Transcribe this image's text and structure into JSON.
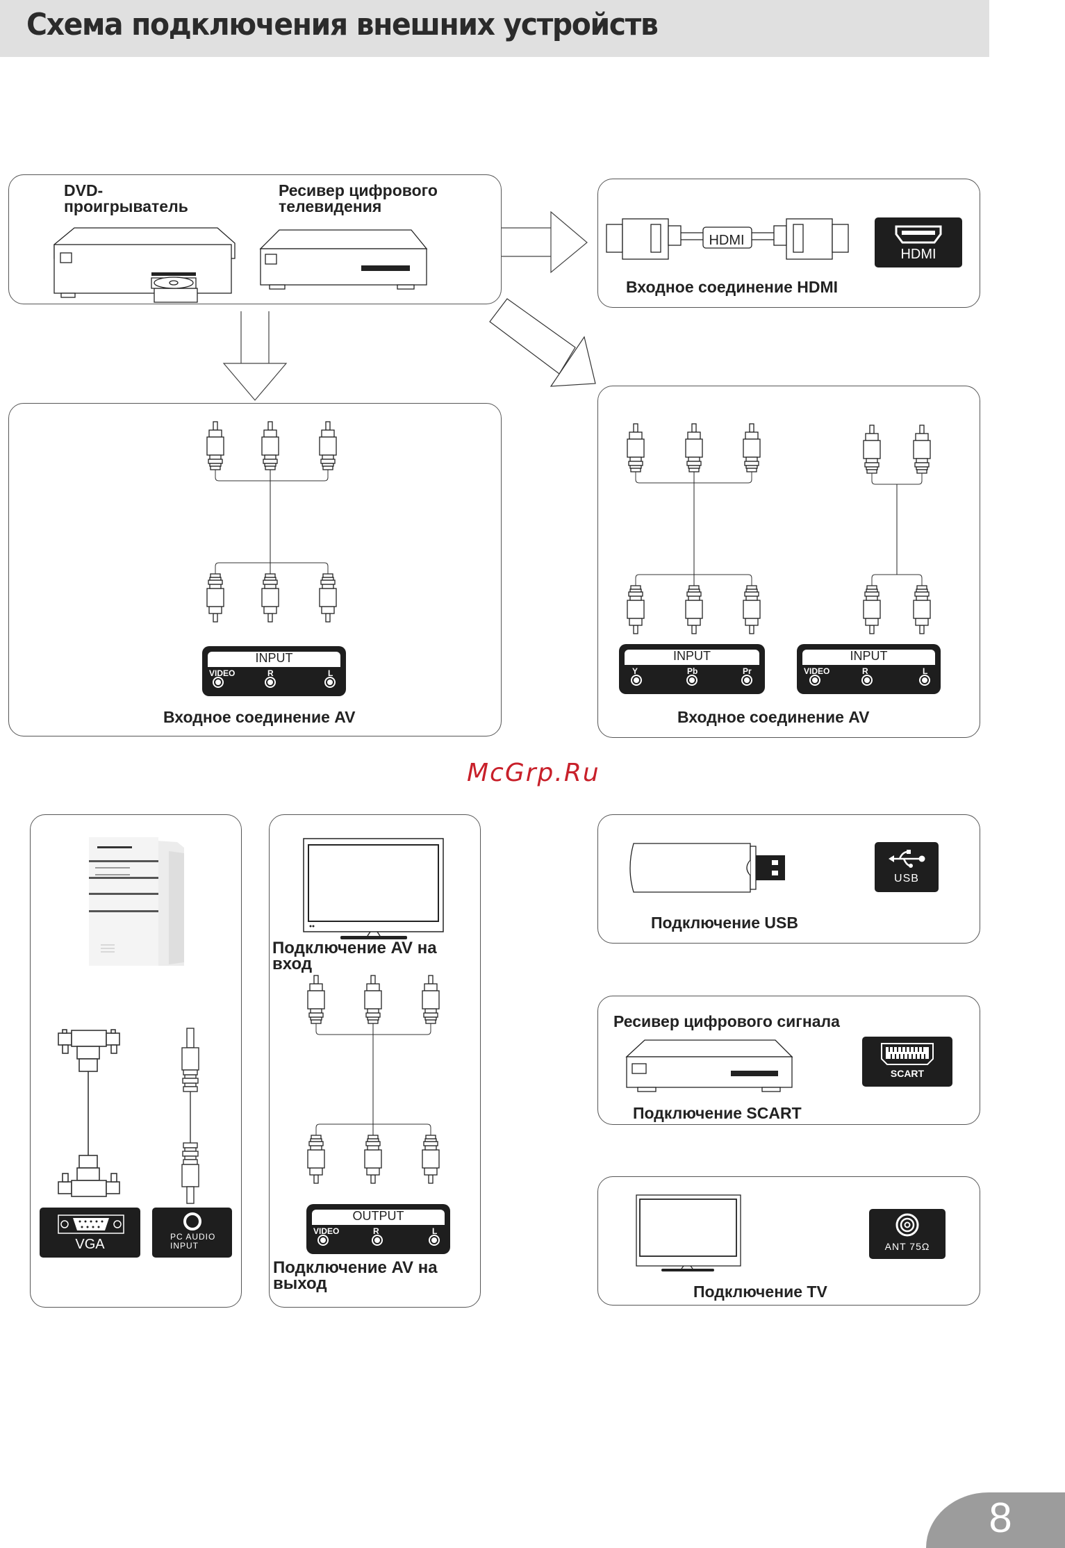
{
  "header": {
    "title": "Схема подключения внешних устройств"
  },
  "watermark": "McGrp.Ru",
  "page_number": "8",
  "sources_panel": {
    "dvd_label": "DVD-\nпроигрыватель",
    "dvd_label_line1": "DVD-",
    "dvd_label_line2": "проигрыватель",
    "receiver_label_line1": "Ресивер цифрового",
    "receiver_label_line2": "телевидения"
  },
  "hdmi_panel": {
    "cable_label": "HDMI",
    "port_label": "HDMI",
    "caption": "Входное соединение HDMI"
  },
  "av_panel_left": {
    "input_title": "INPUT",
    "jacks": [
      "VIDEO",
      "R",
      "L"
    ],
    "caption": "Входное соединение AV"
  },
  "av_panel_right": {
    "component_input": {
      "title": "INPUT",
      "jacks": [
        "Y",
        "Pb",
        "Pr"
      ]
    },
    "audio_input": {
      "title": "INPUT",
      "jacks": [
        "VIDEO",
        "R",
        "L"
      ]
    },
    "caption": "Входное соединение AV"
  },
  "pc_panel": {
    "vga_label": "VGA",
    "audio_label_line1": "PC AUDIO",
    "audio_label_line2": "INPUT"
  },
  "av_out_panel": {
    "caption_in_line1": "Подключение  AV на",
    "caption_in_line2": "вход",
    "output_title": "OUTPUT",
    "jacks": [
      "VIDEO",
      "R",
      "L"
    ],
    "caption_out_line1": "Подключение  AV на",
    "caption_out_line2": "выход"
  },
  "usb_panel": {
    "port_label": "USB",
    "caption": "Подключение  USB"
  },
  "scart_panel": {
    "device_label": "Ресивер цифрового сигнала",
    "port_label": "SCART",
    "caption": "Подключение  SCART"
  },
  "tv_panel": {
    "port_label": "ANT 75Ω",
    "caption": "Подключение  TV"
  }
}
